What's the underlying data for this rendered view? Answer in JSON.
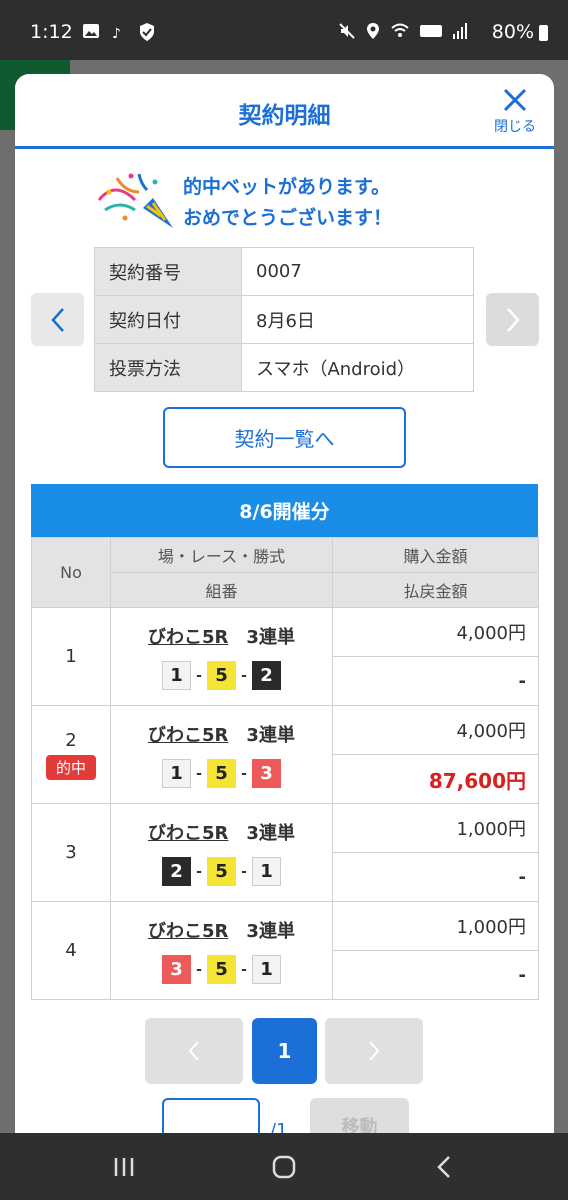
{
  "status": {
    "time": "1:12",
    "battery": "80%"
  },
  "modal": {
    "title": "契約明細",
    "close_label": "閉じる"
  },
  "congrats": {
    "line1": "的中ベットがあります。",
    "line2": "おめでとうございます！"
  },
  "contract": {
    "rows": [
      {
        "label": "契約番号",
        "value": "0007"
      },
      {
        "label": "契約日付",
        "value": "8月6日"
      },
      {
        "label": "投票方法",
        "value": "スマホ（Android）"
      }
    ]
  },
  "list_button": "契約一覧へ",
  "section_title": "8/6開催分",
  "bets_header": {
    "no": "No",
    "race": "場・レース・勝式",
    "amount": "購入金額",
    "combo": "組番",
    "payout": "払戻金額"
  },
  "bets": [
    {
      "no": "1",
      "place": "びわこ5R",
      "type": "3連単",
      "combo": [
        "1",
        "5",
        "2"
      ],
      "amount": "4,000円",
      "payout": "-",
      "hit": false
    },
    {
      "no": "2",
      "place": "びわこ5R",
      "type": "3連単",
      "combo": [
        "1",
        "5",
        "3"
      ],
      "amount": "4,000円",
      "payout": "87,600円",
      "hit": true,
      "hit_label": "的中"
    },
    {
      "no": "3",
      "place": "びわこ5R",
      "type": "3連単",
      "combo": [
        "2",
        "5",
        "1"
      ],
      "amount": "1,000円",
      "payout": "-",
      "hit": false
    },
    {
      "no": "4",
      "place": "びわこ5R",
      "type": "3連単",
      "combo": [
        "3",
        "5",
        "1"
      ],
      "amount": "1,000円",
      "payout": "-",
      "hit": false
    }
  ],
  "pager": {
    "current": "1",
    "total": "/1",
    "move_label": "移動"
  }
}
